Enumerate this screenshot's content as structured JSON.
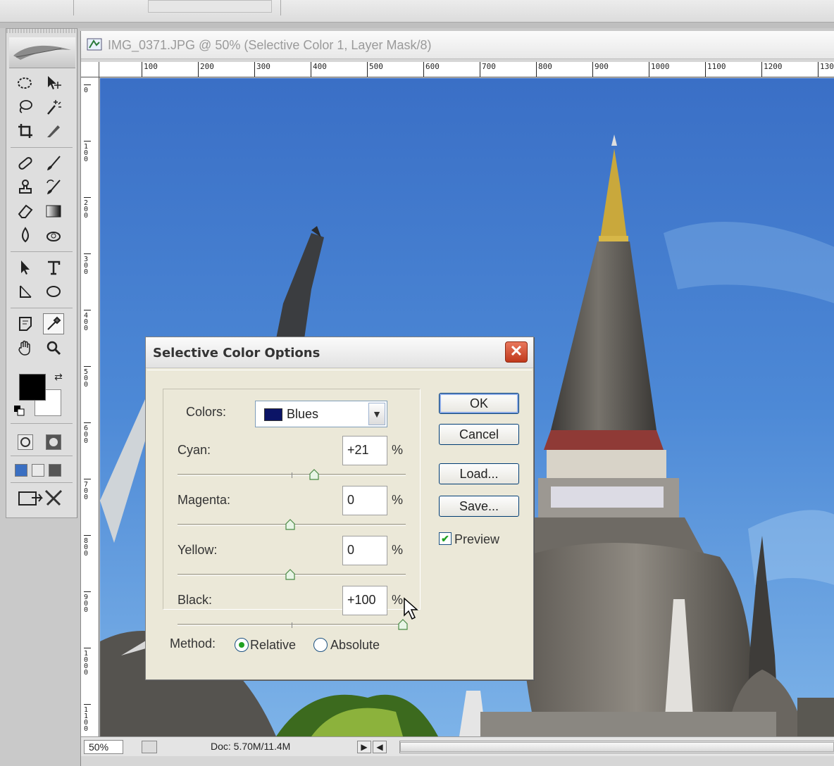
{
  "document": {
    "title": "IMG_0371.JPG @ 50% (Selective Color 1, Layer Mask/8)",
    "zoom": "50%",
    "doc_size": "Doc: 5.70M/11.4M",
    "ruler_h": [
      "100",
      "200",
      "300",
      "400",
      "500",
      "600",
      "700",
      "800",
      "900",
      "1000",
      "1100",
      "1200",
      "130"
    ],
    "ruler_v": [
      "0",
      "100",
      "200",
      "300",
      "400",
      "500",
      "600",
      "700",
      "800",
      "900",
      "1000",
      "1100"
    ]
  },
  "dialog": {
    "title": "Selective Color Options",
    "close": "✕",
    "colors_label": "Colors:",
    "colors_value": "Blues",
    "sliders": [
      {
        "label": "Cyan:",
        "value": "+21",
        "unit": "%",
        "level": 0.605
      },
      {
        "label": "Magenta:",
        "value": "0",
        "unit": "%",
        "level": 0.5
      },
      {
        "label": "Yellow:",
        "value": "0",
        "unit": "%",
        "level": 0.5
      },
      {
        "label": "Black:",
        "value": "+100",
        "unit": "%",
        "level": 1.0
      }
    ],
    "buttons": {
      "ok": "OK",
      "cancel": "Cancel",
      "load": "Load...",
      "save": "Save..."
    },
    "preview_label": "Preview",
    "preview_checked": true,
    "method_label": "Method:",
    "method_options": [
      "Relative",
      "Absolute"
    ],
    "method_selected": "Relative"
  },
  "colors": {
    "sky": "#4a86d4",
    "foreground": "#000000",
    "background": "#ffffff",
    "close_button": "#d4512f"
  }
}
